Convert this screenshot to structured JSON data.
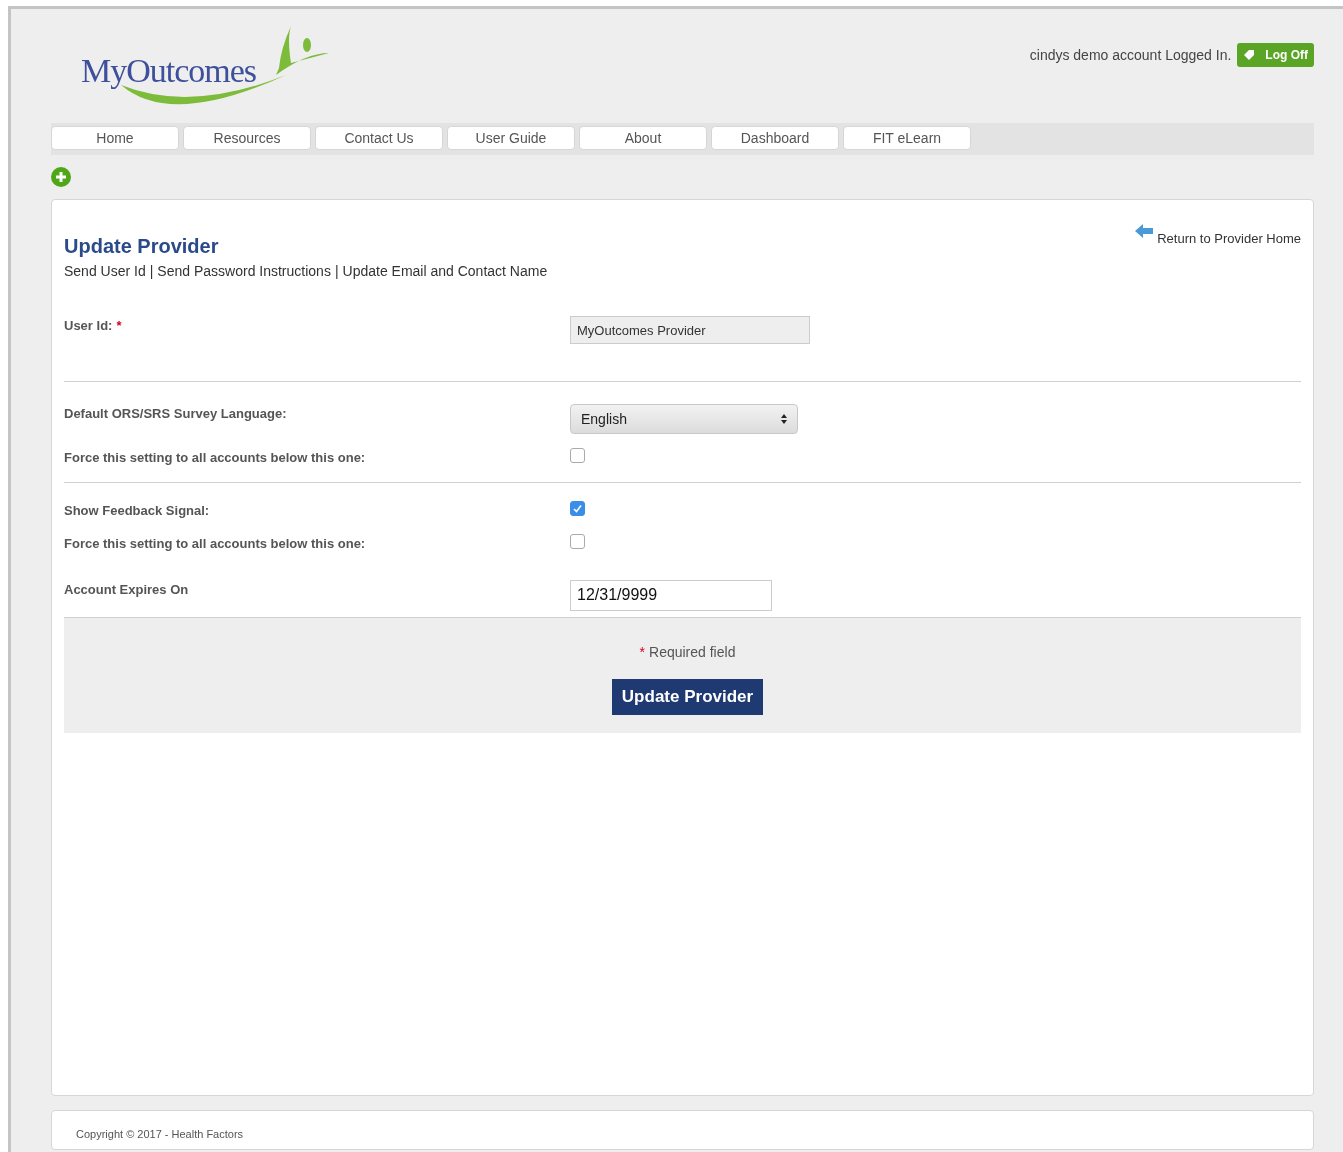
{
  "header": {
    "logo": "MyOutcomes",
    "login_status": "cindys demo account Logged In.",
    "logoff_button": "Log Off"
  },
  "nav": [
    {
      "label": "Home"
    },
    {
      "label": "Resources"
    },
    {
      "label": "Contact Us"
    },
    {
      "label": "User Guide"
    },
    {
      "label": "About"
    },
    {
      "label": "Dashboard"
    },
    {
      "label": "FIT eLearn"
    }
  ],
  "panel": {
    "title": "Update Provider",
    "separator": "|",
    "links": [
      "Send User Id",
      "Send Password Instructions",
      "Update Email and Contact Name"
    ],
    "return_link": "Return to Provider Home",
    "sections": [
      [
        {
          "kind": "readonly",
          "label": "User Id:",
          "required_mark": "*",
          "value": "MyOutcomes Provider"
        }
      ],
      [
        {
          "kind": "select",
          "label": "Default ORS/SRS Survey Language:",
          "value": "English"
        },
        {
          "kind": "checkbox",
          "label": "Force this setting to all accounts below this one:",
          "checked": false
        }
      ],
      [
        {
          "kind": "checkbox",
          "label": "Show Feedback Signal:",
          "checked": true
        },
        {
          "kind": "checkbox",
          "label": "Force this setting to all accounts below this one:",
          "checked": false
        },
        {
          "kind": "input",
          "label": "Account Expires On",
          "value": "12/31/9999"
        }
      ]
    ],
    "required_note": {
      "mark": "*",
      "text": "Required field"
    },
    "submit_button": "Update Provider"
  },
  "footer": {
    "copyright": "Copyright © 2017 - Health Factors"
  }
}
